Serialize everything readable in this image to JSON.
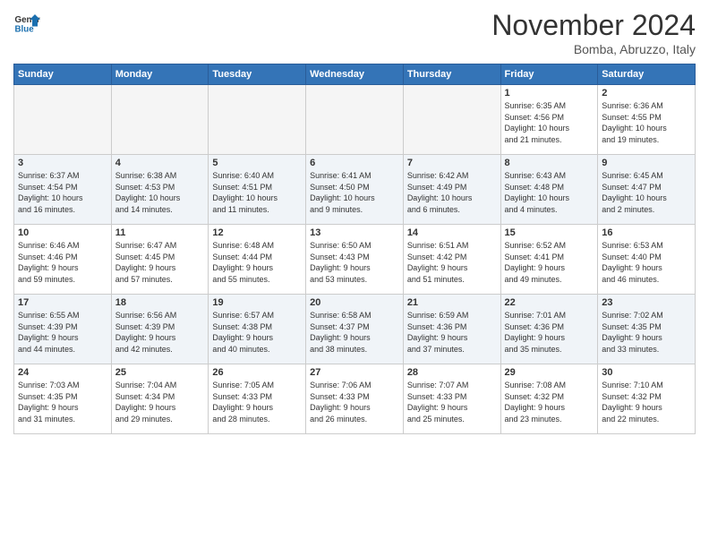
{
  "header": {
    "logo_general": "General",
    "logo_blue": "Blue",
    "title": "November 2024",
    "subtitle": "Bomba, Abruzzo, Italy"
  },
  "weekdays": [
    "Sunday",
    "Monday",
    "Tuesday",
    "Wednesday",
    "Thursday",
    "Friday",
    "Saturday"
  ],
  "weeks": [
    [
      {
        "day": "",
        "info": ""
      },
      {
        "day": "",
        "info": ""
      },
      {
        "day": "",
        "info": ""
      },
      {
        "day": "",
        "info": ""
      },
      {
        "day": "",
        "info": ""
      },
      {
        "day": "1",
        "info": "Sunrise: 6:35 AM\nSunset: 4:56 PM\nDaylight: 10 hours\nand 21 minutes."
      },
      {
        "day": "2",
        "info": "Sunrise: 6:36 AM\nSunset: 4:55 PM\nDaylight: 10 hours\nand 19 minutes."
      }
    ],
    [
      {
        "day": "3",
        "info": "Sunrise: 6:37 AM\nSunset: 4:54 PM\nDaylight: 10 hours\nand 16 minutes."
      },
      {
        "day": "4",
        "info": "Sunrise: 6:38 AM\nSunset: 4:53 PM\nDaylight: 10 hours\nand 14 minutes."
      },
      {
        "day": "5",
        "info": "Sunrise: 6:40 AM\nSunset: 4:51 PM\nDaylight: 10 hours\nand 11 minutes."
      },
      {
        "day": "6",
        "info": "Sunrise: 6:41 AM\nSunset: 4:50 PM\nDaylight: 10 hours\nand 9 minutes."
      },
      {
        "day": "7",
        "info": "Sunrise: 6:42 AM\nSunset: 4:49 PM\nDaylight: 10 hours\nand 6 minutes."
      },
      {
        "day": "8",
        "info": "Sunrise: 6:43 AM\nSunset: 4:48 PM\nDaylight: 10 hours\nand 4 minutes."
      },
      {
        "day": "9",
        "info": "Sunrise: 6:45 AM\nSunset: 4:47 PM\nDaylight: 10 hours\nand 2 minutes."
      }
    ],
    [
      {
        "day": "10",
        "info": "Sunrise: 6:46 AM\nSunset: 4:46 PM\nDaylight: 9 hours\nand 59 minutes."
      },
      {
        "day": "11",
        "info": "Sunrise: 6:47 AM\nSunset: 4:45 PM\nDaylight: 9 hours\nand 57 minutes."
      },
      {
        "day": "12",
        "info": "Sunrise: 6:48 AM\nSunset: 4:44 PM\nDaylight: 9 hours\nand 55 minutes."
      },
      {
        "day": "13",
        "info": "Sunrise: 6:50 AM\nSunset: 4:43 PM\nDaylight: 9 hours\nand 53 minutes."
      },
      {
        "day": "14",
        "info": "Sunrise: 6:51 AM\nSunset: 4:42 PM\nDaylight: 9 hours\nand 51 minutes."
      },
      {
        "day": "15",
        "info": "Sunrise: 6:52 AM\nSunset: 4:41 PM\nDaylight: 9 hours\nand 49 minutes."
      },
      {
        "day": "16",
        "info": "Sunrise: 6:53 AM\nSunset: 4:40 PM\nDaylight: 9 hours\nand 46 minutes."
      }
    ],
    [
      {
        "day": "17",
        "info": "Sunrise: 6:55 AM\nSunset: 4:39 PM\nDaylight: 9 hours\nand 44 minutes."
      },
      {
        "day": "18",
        "info": "Sunrise: 6:56 AM\nSunset: 4:39 PM\nDaylight: 9 hours\nand 42 minutes."
      },
      {
        "day": "19",
        "info": "Sunrise: 6:57 AM\nSunset: 4:38 PM\nDaylight: 9 hours\nand 40 minutes."
      },
      {
        "day": "20",
        "info": "Sunrise: 6:58 AM\nSunset: 4:37 PM\nDaylight: 9 hours\nand 38 minutes."
      },
      {
        "day": "21",
        "info": "Sunrise: 6:59 AM\nSunset: 4:36 PM\nDaylight: 9 hours\nand 37 minutes."
      },
      {
        "day": "22",
        "info": "Sunrise: 7:01 AM\nSunset: 4:36 PM\nDaylight: 9 hours\nand 35 minutes."
      },
      {
        "day": "23",
        "info": "Sunrise: 7:02 AM\nSunset: 4:35 PM\nDaylight: 9 hours\nand 33 minutes."
      }
    ],
    [
      {
        "day": "24",
        "info": "Sunrise: 7:03 AM\nSunset: 4:35 PM\nDaylight: 9 hours\nand 31 minutes."
      },
      {
        "day": "25",
        "info": "Sunrise: 7:04 AM\nSunset: 4:34 PM\nDaylight: 9 hours\nand 29 minutes."
      },
      {
        "day": "26",
        "info": "Sunrise: 7:05 AM\nSunset: 4:33 PM\nDaylight: 9 hours\nand 28 minutes."
      },
      {
        "day": "27",
        "info": "Sunrise: 7:06 AM\nSunset: 4:33 PM\nDaylight: 9 hours\nand 26 minutes."
      },
      {
        "day": "28",
        "info": "Sunrise: 7:07 AM\nSunset: 4:33 PM\nDaylight: 9 hours\nand 25 minutes."
      },
      {
        "day": "29",
        "info": "Sunrise: 7:08 AM\nSunset: 4:32 PM\nDaylight: 9 hours\nand 23 minutes."
      },
      {
        "day": "30",
        "info": "Sunrise: 7:10 AM\nSunset: 4:32 PM\nDaylight: 9 hours\nand 22 minutes."
      }
    ]
  ]
}
